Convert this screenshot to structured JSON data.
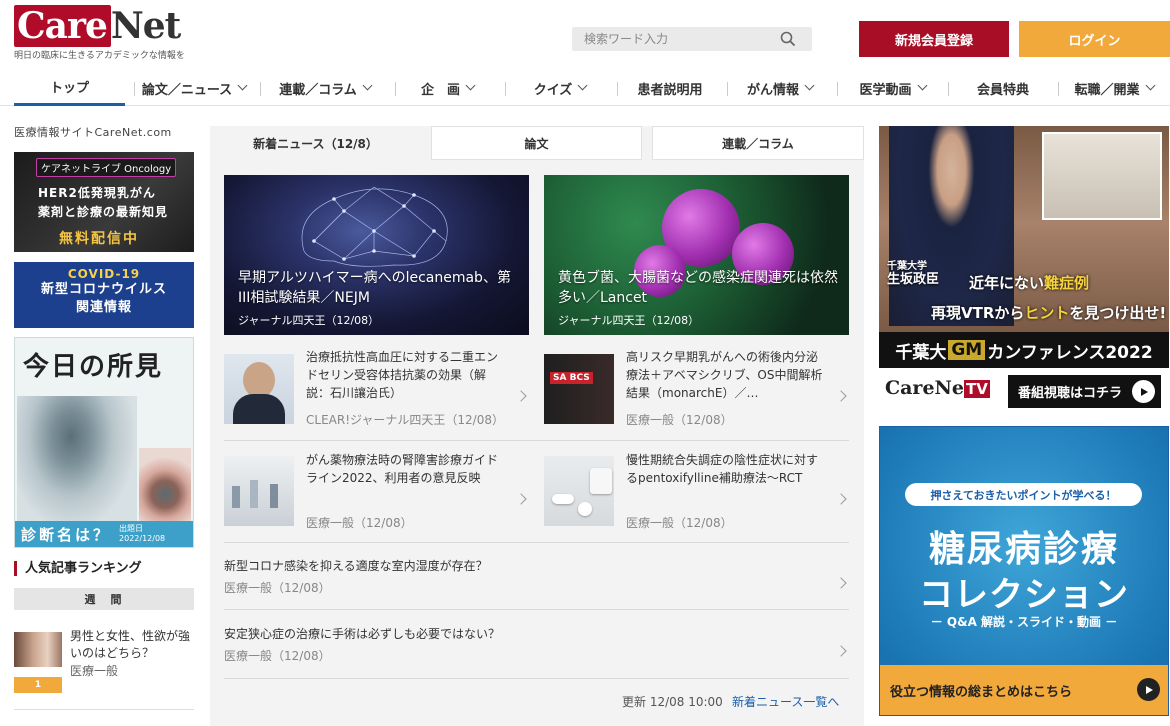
{
  "header": {
    "logo_text_a": "Care",
    "logo_text_b": "Net",
    "tagline": "明日の臨床に生きるアカデミックな情報を",
    "search_placeholder": "検索ワード入力",
    "register_label": "新規会員登録",
    "login_label": "ログイン"
  },
  "nav": {
    "items": [
      {
        "label": "トップ"
      },
      {
        "label": "論文／ニュース"
      },
      {
        "label": "連載／コラム"
      },
      {
        "label": "企　画"
      },
      {
        "label": "クイズ"
      },
      {
        "label": "患者説明用"
      },
      {
        "label": "がん情報"
      },
      {
        "label": "医学動画"
      },
      {
        "label": "会員特典"
      },
      {
        "label": "転職／開業"
      }
    ]
  },
  "left": {
    "site_label": "医療情報サイトCareNet.com",
    "banner1": {
      "pill": "ケアネットライブ Oncology",
      "line1": "HER2低発現乳がん",
      "line2": "薬剤と診療の最新知見",
      "cta": "無料配信中"
    },
    "banner2": {
      "line1": "COVID-19",
      "line2": "新型コロナウイルス",
      "line3": "関連情報"
    },
    "banner3": {
      "title": "今日の所見",
      "question": "診断名は？",
      "date_label": "出題日",
      "date": "2022/12/08"
    },
    "ranking": {
      "title": "人気記事ランキング",
      "tab": "週　間",
      "items": [
        {
          "rank": "1",
          "title": "男性と女性、性欲が強いのはどちら？",
          "category": "医療一般"
        }
      ]
    }
  },
  "center": {
    "tabs": [
      {
        "label": "新着ニュース（12/8）"
      },
      {
        "label": "論文"
      },
      {
        "label": "連載／コラム"
      }
    ],
    "featured": [
      {
        "title": "早期アルツハイマー病へのlecanemab、第III相試験結果／NEJM",
        "category": "ジャーナル四天王（12/08）"
      },
      {
        "title": "黄色ブ菌、大腸菌などの感染症関連死は依然多い／Lancet",
        "category": "ジャーナル四天王（12/08）"
      }
    ],
    "articles": [
      {
        "title": "治療抵抗性高血圧に対する二重エンドセリン受容体拮抗薬の効果（解説：石川讓治氏）",
        "category": "CLEAR!ジャーナル四天王（12/08）"
      },
      {
        "title": "高リスク早期乳がんへの術後内分泌療法＋アベマシクリブ、OS中間解析結果（monarchE）／…",
        "category": "医療一般（12/08）"
      },
      {
        "title": "がん薬物療法時の腎障害診療ガイドライン2022、利用者の意見反映",
        "category": "医療一般（12/08）"
      },
      {
        "title": "慢性期統合失調症の陰性症状に対するpentoxifylline補助療法～RCT",
        "category": "医療一般（12/08）"
      }
    ],
    "wide_articles": [
      {
        "title": "新型コロナ感染を抑える適度な室内湿度が存在？",
        "category": "医療一般（12/08）"
      },
      {
        "title": "安定狭心症の治療に手術は必ずしも必要ではない？",
        "category": "医療一般（12/08）"
      }
    ],
    "sabcs_label": "SA BCS",
    "update_text": "更新 12/08 10:00",
    "more_link": "新着ニュース一覧へ"
  },
  "right": {
    "tv_ad": {
      "affiliation": "千葉大学",
      "name": "生坂政臣",
      "headline_a": "近年にない",
      "headline_b": "難症例",
      "sub_a": "再現VTRから",
      "sub_b": "ヒント",
      "sub_c": "を見つけ出せ!",
      "bar_a": "千葉大",
      "bar_gm": "GM",
      "bar_b": "カンファレンス2022"
    },
    "tv_logo_a": "CareNe",
    "tv_logo_b": "TV",
    "tv_button": "番組視聴はコチラ",
    "dm_ad": {
      "pill": "押さえておきたいポイントが学べる！",
      "line1": "糖尿病診療",
      "line2": "コレクション",
      "line3": "－ Q&A 解説・スライド・動画 －",
      "cta": "役立つ情報の総まとめはこちら"
    }
  },
  "colors": {
    "brand_red": "#a80e25",
    "accent_orange": "#f2a93b",
    "link_blue": "#1b5fa8"
  }
}
